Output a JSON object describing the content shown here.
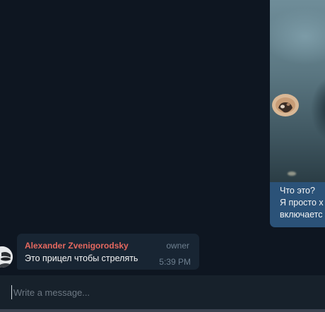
{
  "media_message": {
    "caption_lines": [
      "Что это?",
      "Я просто х",
      "включаетс"
    ]
  },
  "incoming_message": {
    "sender": "Alexander Zvenigorodsky",
    "badge": "owner",
    "text": "Это прицел чтобы стрелять",
    "time": "5:39 PM",
    "colors": {
      "sender": "#e5685f",
      "bubble": "#182533"
    }
  },
  "composer": {
    "placeholder": "Write a message...",
    "value": ""
  },
  "colors": {
    "background": "#0e1621",
    "outgoing_bubble": "#2b5278",
    "composer": "#17212b"
  }
}
